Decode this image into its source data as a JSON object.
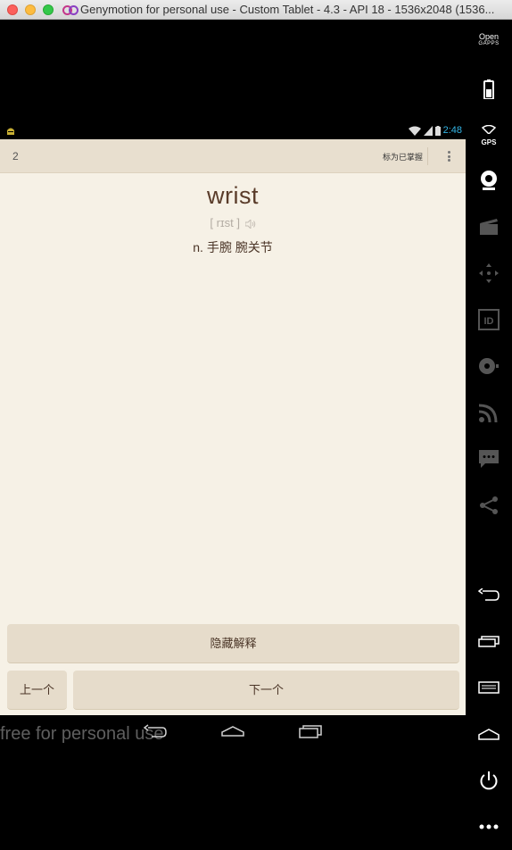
{
  "window": {
    "title": "Genymotion for personal use - Custom Tablet - 4.3 - API 18 - 1536x2048 (1536..."
  },
  "status_bar": {
    "time": "2:48",
    "icons": [
      "android-notification-icon",
      "wifi-icon",
      "signal-icon",
      "battery-icon"
    ]
  },
  "action_bar": {
    "counter": "2",
    "mark_label": "标为已掌握",
    "overflow_icon": "overflow-menu-icon"
  },
  "card": {
    "word": "wrist",
    "phonetic": "[ rɪst ]",
    "definition": "n. 手腕 腕关节"
  },
  "buttons": {
    "hide": "隐藏解释",
    "prev": "上一个",
    "next": "下一个"
  },
  "nav_bar": {
    "watermark": "free for personal use",
    "icons": [
      "back-icon",
      "home-icon",
      "recents-icon"
    ]
  },
  "sidebar": {
    "opengapps_line1": "Open",
    "opengapps_line2": "GAPPS",
    "gps_label": "GPS",
    "icons": [
      "opengapps-icon",
      "battery-icon",
      "gps-icon",
      "webcam-icon",
      "screencast-icon",
      "dpad-icon",
      "device-id-icon",
      "disk-icon",
      "network-icon",
      "sms-icon",
      "share-icon",
      "back-icon",
      "recents-icon",
      "menu-icon",
      "home-icon",
      "power-icon",
      "more-icon"
    ]
  },
  "colors": {
    "screen_bg": "#f6f1e6",
    "actionbar_bg": "#e8dfcf",
    "button_bg": "#e6dccb",
    "word_color": "#5a3c2a",
    "status_accent": "#33b5e5"
  }
}
